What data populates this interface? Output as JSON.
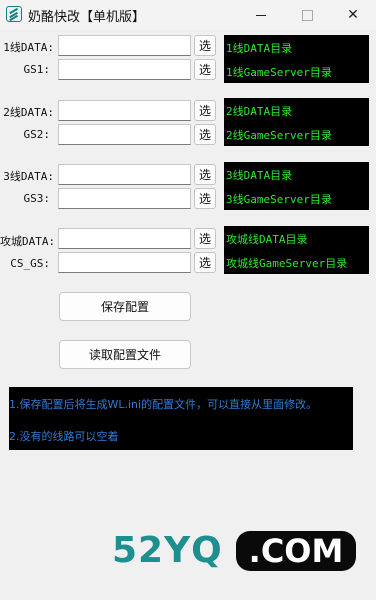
{
  "window": {
    "title": "奶酪快改【单机版】",
    "controls": {
      "minimize": "—",
      "close": "✕"
    }
  },
  "pick_label": "选",
  "groups": [
    {
      "label1": "1线DATA:",
      "label2": "GS1:",
      "value1": "",
      "value2": "",
      "panel_line1": "1线DATA目录",
      "panel_line2": "1线GameServer目录"
    },
    {
      "label1": "2线DATA:",
      "label2": "GS2:",
      "value1": "",
      "value2": "",
      "panel_line1": "2线DATA目录",
      "panel_line2": "2线GameServer目录"
    },
    {
      "label1": "3线DATA:",
      "label2": "GS3:",
      "value1": "",
      "value2": "",
      "panel_line1": "3线DATA目录",
      "panel_line2": "3线GameServer目录"
    },
    {
      "label1": "攻城DATA:",
      "label2": "CS_GS:",
      "value1": "",
      "value2": "",
      "panel_line1": "攻城线DATA目录",
      "panel_line2": "攻城线GameServer目录"
    }
  ],
  "buttons": {
    "save": "保存配置",
    "load": "读取配置文件"
  },
  "notes": [
    "1.保存配置后将生成WL.ini的配置文件，可以直接从里面修改。",
    "2.没有的线路可以空着"
  ],
  "watermark": {
    "left": "52YQ",
    "right": ".COM"
  },
  "colors": {
    "panel_text": "#2ee82e",
    "notes_text": "#2e7bd6",
    "watermark": "#1d8f8f"
  }
}
